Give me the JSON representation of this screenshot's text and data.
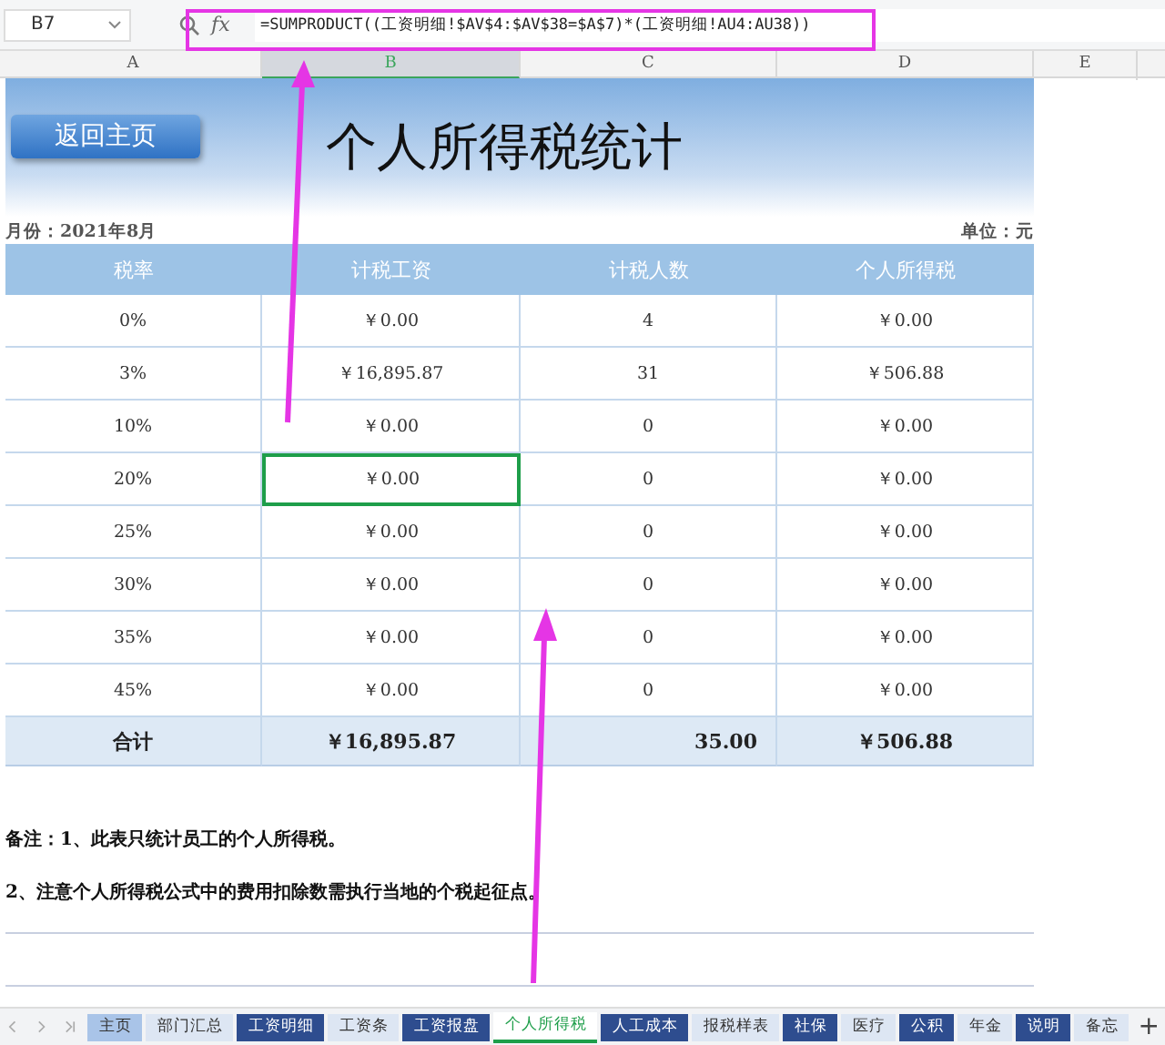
{
  "formula_bar": {
    "name_box": "B7",
    "fx": "fx",
    "formula": "=SUMPRODUCT((工资明细!$AV$4:$AV$38=$A$7)*(工资明细!AU4:AU38))"
  },
  "columns": [
    {
      "label": "A",
      "selected": false
    },
    {
      "label": "B",
      "selected": true
    },
    {
      "label": "C",
      "selected": false
    },
    {
      "label": "D",
      "selected": false
    },
    {
      "label": "E",
      "selected": false
    }
  ],
  "sheet": {
    "button": "返回主页",
    "title": "个人所得税统计",
    "month": "月份：2021年8月",
    "unit": "单位：元",
    "headers": [
      "税率",
      "计税工资",
      "计税人数",
      "个人所得税"
    ],
    "rows": [
      {
        "cells": [
          {
            "text": "0%",
            "selected": false
          },
          {
            "text": "￥0.00",
            "selected": false
          },
          {
            "text": "4",
            "selected": false
          },
          {
            "text": "￥0.00",
            "selected": false
          }
        ]
      },
      {
        "cells": [
          {
            "text": "3%",
            "selected": false
          },
          {
            "text": "￥16,895.87",
            "selected": false
          },
          {
            "text": "31",
            "selected": false
          },
          {
            "text": "￥506.88",
            "selected": false
          }
        ]
      },
      {
        "cells": [
          {
            "text": "10%",
            "selected": false
          },
          {
            "text": "￥0.00",
            "selected": false
          },
          {
            "text": "0",
            "selected": false
          },
          {
            "text": "￥0.00",
            "selected": false
          }
        ]
      },
      {
        "cells": [
          {
            "text": "20%",
            "selected": false
          },
          {
            "text": "￥0.00",
            "selected": true
          },
          {
            "text": "0",
            "selected": false
          },
          {
            "text": "￥0.00",
            "selected": false
          }
        ]
      },
      {
        "cells": [
          {
            "text": "25%",
            "selected": false
          },
          {
            "text": "￥0.00",
            "selected": false
          },
          {
            "text": "0",
            "selected": false
          },
          {
            "text": "￥0.00",
            "selected": false
          }
        ]
      },
      {
        "cells": [
          {
            "text": "30%",
            "selected": false
          },
          {
            "text": "￥0.00",
            "selected": false
          },
          {
            "text": "0",
            "selected": false
          },
          {
            "text": "￥0.00",
            "selected": false
          }
        ]
      },
      {
        "cells": [
          {
            "text": "35%",
            "selected": false
          },
          {
            "text": "￥0.00",
            "selected": false
          },
          {
            "text": "0",
            "selected": false
          },
          {
            "text": "￥0.00",
            "selected": false
          }
        ]
      },
      {
        "cells": [
          {
            "text": "45%",
            "selected": false
          },
          {
            "text": "￥0.00",
            "selected": false
          },
          {
            "text": "0",
            "selected": false
          },
          {
            "text": "￥0.00",
            "selected": false
          }
        ]
      }
    ],
    "total": [
      "合计",
      "￥16,895.87",
      "35.00",
      "￥506.88"
    ],
    "notes": [
      "备注：1、此表只统计员工的个人所得税。",
      "2、注意个人所得税公式中的费用扣除数需执行当地的个税起征点。"
    ]
  },
  "sheet_tabs": [
    {
      "label": "主页",
      "color": "#a9c4e8",
      "selected": false
    },
    {
      "label": "部门汇总",
      "color": "#dde6f3",
      "selected": false
    },
    {
      "label": "工资明细",
      "color": "#2e4d8f",
      "selected": false
    },
    {
      "label": "工资条",
      "color": "#dde6f3",
      "selected": false
    },
    {
      "label": "工资报盘",
      "color": "#2e4d8f",
      "selected": false
    },
    {
      "label": "个人所得税",
      "color": "#ffffff",
      "selected": true
    },
    {
      "label": "人工成本",
      "color": "#2e4d8f",
      "selected": false
    },
    {
      "label": "报税样表",
      "color": "#dde6f3",
      "selected": false
    },
    {
      "label": "社保",
      "color": "#2e4d8f",
      "selected": false
    },
    {
      "label": "医疗",
      "color": "#dde6f3",
      "selected": false
    },
    {
      "label": "公积",
      "color": "#2e4d8f",
      "selected": false
    },
    {
      "label": "年金",
      "color": "#dde6f3",
      "selected": false
    },
    {
      "label": "说明",
      "color": "#2e4d8f",
      "selected": false
    },
    {
      "label": "备忘",
      "color": "#dde6f3",
      "selected": false
    }
  ],
  "add_tab": "+"
}
